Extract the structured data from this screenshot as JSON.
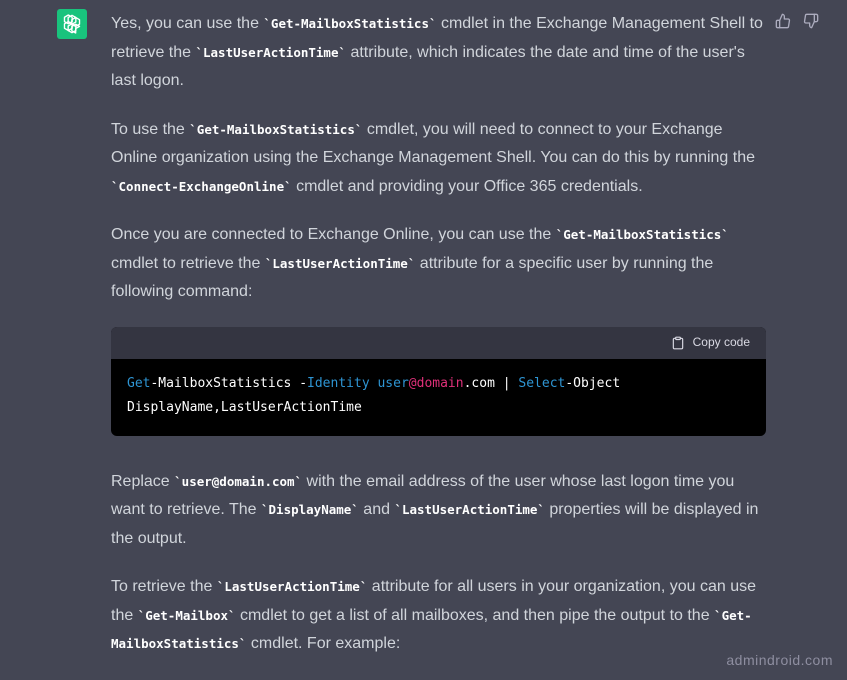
{
  "assistant": {
    "avatar_icon": "openai-logo-icon",
    "avatar_color": "#19c37d"
  },
  "feedback": {
    "thumbs_up_icon": "thumbs-up-icon",
    "thumbs_down_icon": "thumbs-down-icon"
  },
  "message": {
    "p1": {
      "t1": "Yes, you can use the ",
      "c1": "`Get-MailboxStatistics`",
      "t2": " cmdlet in the Exchange Management Shell to retrieve the ",
      "c2": "`LastUserActionTime`",
      "t3": " attribute, which indicates the date and time of the user's last logon."
    },
    "p2": {
      "t1": "To use the ",
      "c1": "`Get-MailboxStatistics`",
      "t2": " cmdlet, you will need to connect to your Exchange Online organization using the Exchange Management Shell. You can do this by running the ",
      "c2": "`Connect-ExchangeOnline`",
      "t3": " cmdlet and providing your Office 365 credentials."
    },
    "p3": {
      "t1": "Once you are connected to Exchange Online, you can use the ",
      "c1": "`Get-MailboxStatistics`",
      "t2": " cmdlet to retrieve the ",
      "c2": "`LastUserActionTime`",
      "t3": " attribute for a specific user by running the following command:"
    },
    "code_block": {
      "copy_label": "Copy code",
      "copy_icon": "clipboard-icon",
      "tokens": {
        "get": "Get",
        "cmd1_rest": "-MailboxStatistics -",
        "identity": "Identity",
        "space1": " ",
        "user": "user",
        "at_domain": "@domain",
        "dot_com": ".com | ",
        "select": "Select",
        "object": "-Object",
        "line2": "DisplayName,LastUserActionTime"
      }
    },
    "p4": {
      "t1": "Replace ",
      "c1": "`user@domain.com`",
      "t2": " with the email address of the user whose last logon time you want to retrieve. The ",
      "c2": "`DisplayName`",
      "t3": " and ",
      "c3": "`LastUserActionTime`",
      "t4": " properties will be displayed in the output."
    },
    "p5": {
      "t1": "To retrieve the ",
      "c1": "`LastUserActionTime`",
      "t2": " attribute for all users in your organization, you can use the ",
      "c2": "`Get-Mailbox`",
      "t3": " cmdlet to get a list of all mailboxes, and then pipe the output to the ",
      "c3": "`Get-MailboxStatistics`",
      "t4": " cmdlet. For example:"
    }
  },
  "watermark": "admindroid.com"
}
